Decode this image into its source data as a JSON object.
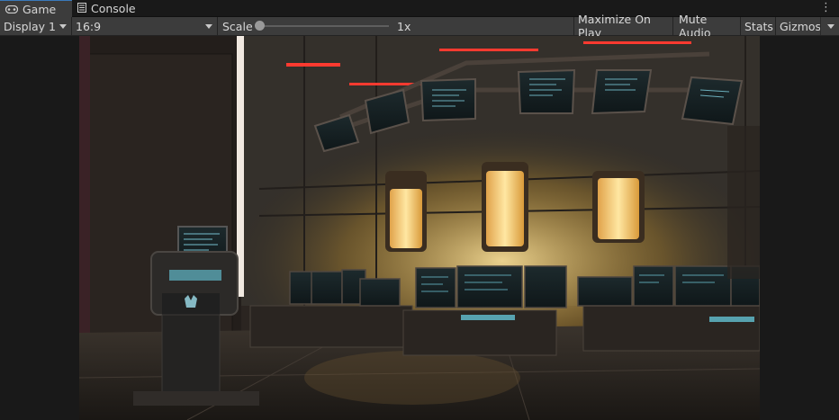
{
  "tabs": [
    {
      "label": "Game",
      "icon": "gamepad-icon",
      "active": true
    },
    {
      "label": "Console",
      "icon": "console-icon",
      "active": false
    }
  ],
  "toolbar": {
    "display": "Display 1",
    "aspect": "16:9",
    "scale_label": "Scale",
    "scale_value": "1x",
    "maximize_on_play": "Maximize On Play",
    "mute_audio": "Mute Audio",
    "stats": "Stats",
    "gizmos": "Gizmos"
  },
  "colors": {
    "accent": "#3a79bb",
    "toolbar_bg": "#3c3c3c",
    "panel_bg": "#191919",
    "glow": "#ffd36b",
    "screen": "#5fb8c8",
    "neon_red": "#ff3a30"
  }
}
